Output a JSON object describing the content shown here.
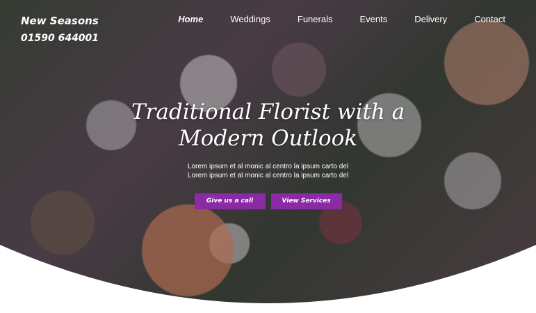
{
  "brand": {
    "name": "New Seasons",
    "phone": "01590 644001"
  },
  "nav": [
    "Home",
    "Weddings",
    "Funerals",
    "Events",
    "Delivery",
    "Contact"
  ],
  "hero": {
    "headline_line1": "Traditional Florist with a",
    "headline_line2": "Modern Outlook",
    "sub_line1": "Lorem ipsum et al monic al centro la ipsum carto del",
    "sub_line2": "Lorem ipsum et al monic al centro la ipsum carto del",
    "cta_call": "Give us a call",
    "cta_services": "View Services"
  },
  "colors": {
    "accent": "#8a2aa5",
    "background": "#ffffff"
  }
}
